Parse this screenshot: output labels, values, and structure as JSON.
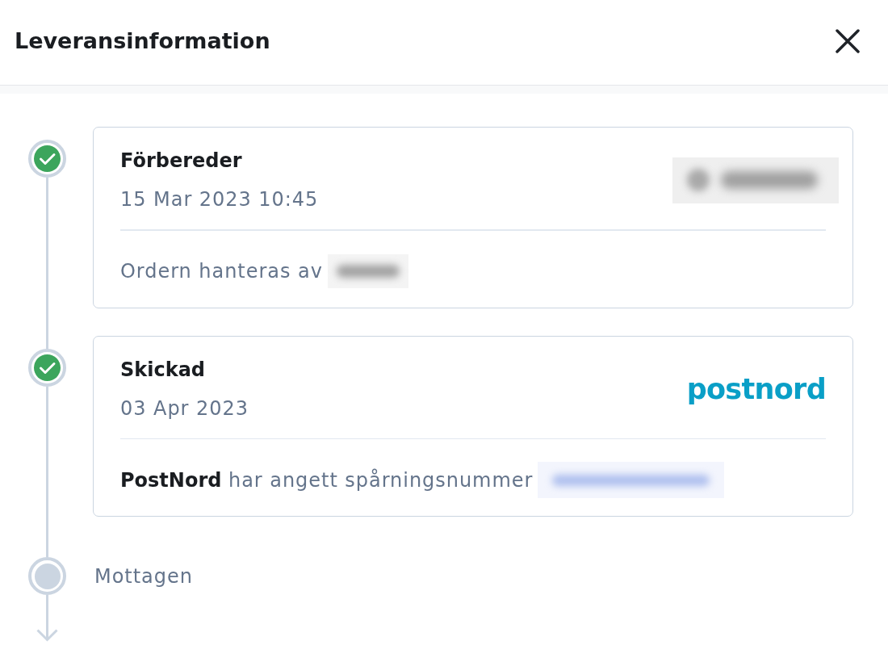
{
  "dialog": {
    "title": "Leveransinformation"
  },
  "timeline": {
    "steps": [
      {
        "kind": "card",
        "completed": true,
        "title": "Förbereder",
        "date": "15 Mar 2023 10:45",
        "logo": {
          "kind": "blurred"
        },
        "message": {
          "text": "Ordern hanteras av",
          "redacted": {
            "kind": "text"
          }
        }
      },
      {
        "kind": "card",
        "completed": true,
        "title": "Skickad",
        "date": "03 Apr 2023",
        "logo": {
          "kind": "wordmark",
          "text": "postnord"
        },
        "message": {
          "text": "**PostNord** har angett spårningsnummer",
          "redacted": {
            "kind": "link"
          }
        }
      },
      {
        "kind": "label",
        "completed": false,
        "title": "Mottagen"
      }
    ]
  }
}
